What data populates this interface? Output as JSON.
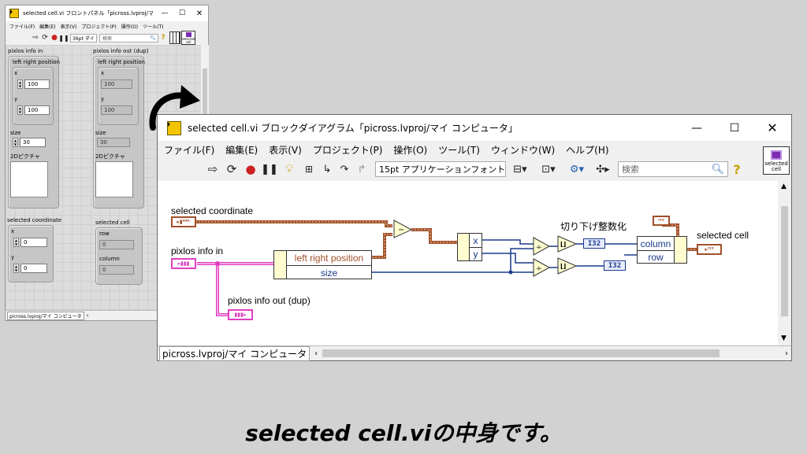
{
  "front_panel": {
    "title": "selected cell.vi フロントパネル「picross.lvproj/マイ…",
    "menu": [
      "ファイル(F)",
      "編集(E)",
      "表示(V)",
      "プロジェクト(P)",
      "操作(O)",
      "ツール(T)"
    ],
    "font_combo": "36pt ダイ",
    "search_placeholder": "検索",
    "vi_icon_text": "selected cell",
    "controls": {
      "pixlos_in_label": "pixlos info in",
      "pixlos_out_label": "pixlos info out (dup)",
      "lrp_label": "left right position",
      "x_label": "x",
      "y_label": "y",
      "x_in": "100",
      "y_in": "100",
      "x_out": "100",
      "y_out": "100",
      "size_label": "size",
      "size_in": "30",
      "size_out": "30",
      "picture_label": "2Dピクチャ",
      "selected_coordinate_label": "selected coordinate",
      "sc_x": "0",
      "sc_y": "0",
      "selected_cell_label": "selected cell",
      "row_label": "row",
      "row_value": "0",
      "column_label": "column",
      "column_value": "0"
    },
    "status_path": "picross.lvproj/マイ コンピュータ"
  },
  "block_diagram": {
    "title": "selected cell.vi ブロックダイアグラム「picross.lvproj/マイ コンピュータ」",
    "menu": [
      "ファイル(F)",
      "編集(E)",
      "表示(V)",
      "プロジェクト(P)",
      "操作(O)",
      "ツール(T)",
      "ウィンドウ(W)",
      "ヘルプ(H)"
    ],
    "font_combo": "15pt アプリケーションフォント",
    "search_placeholder": "検索",
    "vi_icon_text": "selected cell",
    "labels": {
      "selected_coordinate": "selected coordinate",
      "pixlos_in": "pixlos info in",
      "pixlos_out": "pixlos info out (dup)",
      "selected_cell": "selected cell",
      "floor_note": "切り下げ整数化",
      "lrp": "left right position",
      "size": "size",
      "x": "x",
      "y": "y",
      "column": "column",
      "row": "row",
      "i32": "I32"
    },
    "status_path": "picross.lvproj/マイ コンピュータ"
  },
  "caption": "selected cell.viの中身です。",
  "colors": {
    "cluster_wire": "#a0502a",
    "pink_wire": "#e040c0",
    "blue_wire": "#1a3a8a",
    "lv_yellow": "#f5c400"
  }
}
